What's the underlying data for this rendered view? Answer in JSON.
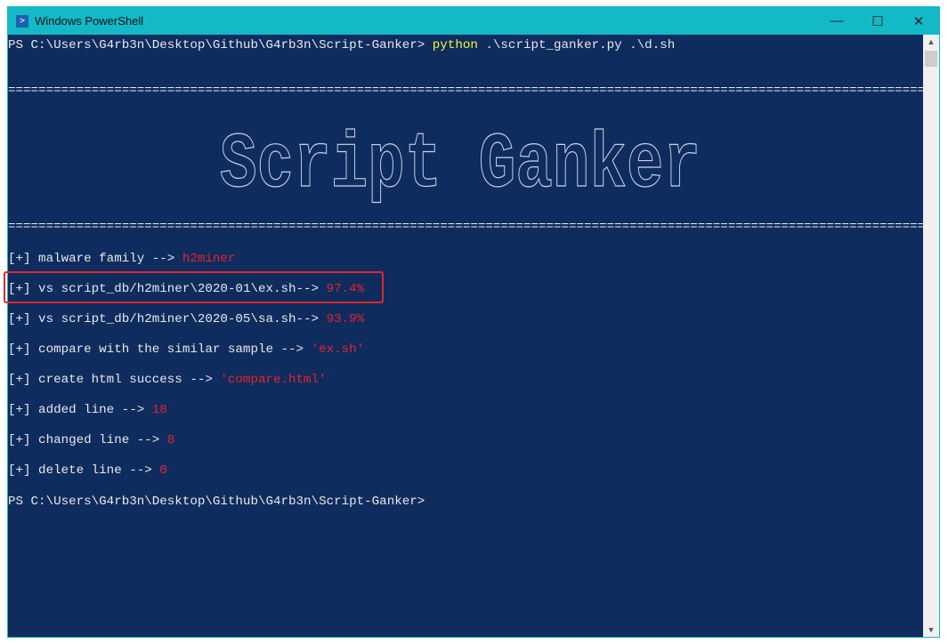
{
  "window": {
    "title": "Windows PowerShell",
    "minimize": "—",
    "maximize": "☐",
    "close": "✕"
  },
  "colors": {
    "titlebar": "#14b9c8",
    "terminal_bg": "#0f2c5e",
    "highlight": "#e3242b",
    "command": "#f5f53a"
  },
  "terminal": {
    "prompt": "PS C:\\Users\\G4rb3n\\Desktop\\Github\\G4rb3n\\Script-Ganker> ",
    "command": "python",
    "args": " .\\script_ganker.py .\\d.sh",
    "separator": "========================================================================================================================================",
    "banner": "Script Ganker",
    "lines": [
      {
        "text": "[+] malware family --> ",
        "value": "h2miner"
      },
      {
        "text": "[+] vs script_db/h2miner\\2020-01\\ex.sh--> ",
        "value": "97.4%"
      },
      {
        "text": "[+] vs script_db/h2miner\\2020-05\\sa.sh--> ",
        "value": "93.9%"
      },
      {
        "text": "[+] compare with the similar sample --> ",
        "value": "'ex.sh'"
      },
      {
        "text": "[+] create html success --> ",
        "value": "'compare.html'"
      },
      {
        "text": "[+] added line --> ",
        "value": "18"
      },
      {
        "text": "[+] changed line --> ",
        "value": "8"
      },
      {
        "text": "[+] delete line --> ",
        "value": "0"
      }
    ],
    "final_prompt": "PS C:\\Users\\G4rb3n\\Desktop\\Github\\G4rb3n\\Script-Ganker>"
  }
}
